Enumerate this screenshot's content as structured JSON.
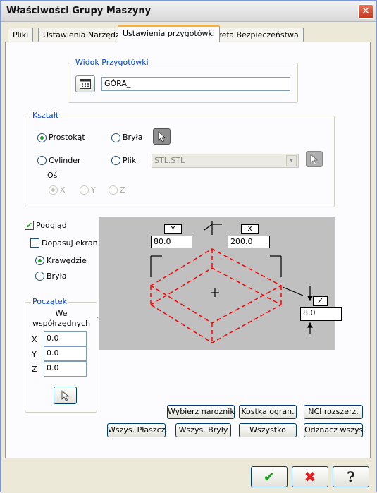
{
  "window": {
    "title": "Właściwości Grupy Maszyny"
  },
  "tabs": [
    "Pliki",
    "Ustawienia Narzędzia",
    "Ustawienia przygotówki",
    "Strefa Bezpieczeństwa"
  ],
  "view_group": {
    "label": "Widok Przygotówki",
    "value": "GÓRA_"
  },
  "shape_group": {
    "label": "Kształt",
    "rect": "Prostokąt",
    "solid": "Bryła",
    "cylinder": "Cylinder",
    "file": "Plik",
    "file_value": "STL.STL",
    "axis_label": "Oś",
    "axis_x": "X",
    "axis_y": "Y",
    "axis_z": "Z"
  },
  "display": {
    "preview": "Podgląd",
    "fit": "Dopasuj ekran",
    "edges": "Krawędzie",
    "solid": "Bryła"
  },
  "origin": {
    "label": "Początek",
    "heading": "We współrzędnych",
    "x_label": "X",
    "x": "0.0",
    "y_label": "Y",
    "y": "0.0",
    "z_label": "Z",
    "z": "0.0"
  },
  "stock": {
    "y_label": "Y",
    "y": "80.0",
    "x_label": "X",
    "x": "200.0",
    "z_label": "Z",
    "z": "8.0"
  },
  "buttons": {
    "corner": "Wybierz narożnik",
    "bounding": "Kostka ogran.",
    "nci": "NCI rozszerz.",
    "all_surfaces": "Wszys. Płaszcz.",
    "all_solids": "Wszys. Bryły",
    "all": "Wszystko",
    "deselect": "Odznacz wszys."
  },
  "colors": {
    "wireframe": "#ff0000",
    "preview_bg": "#c0c0c0"
  }
}
